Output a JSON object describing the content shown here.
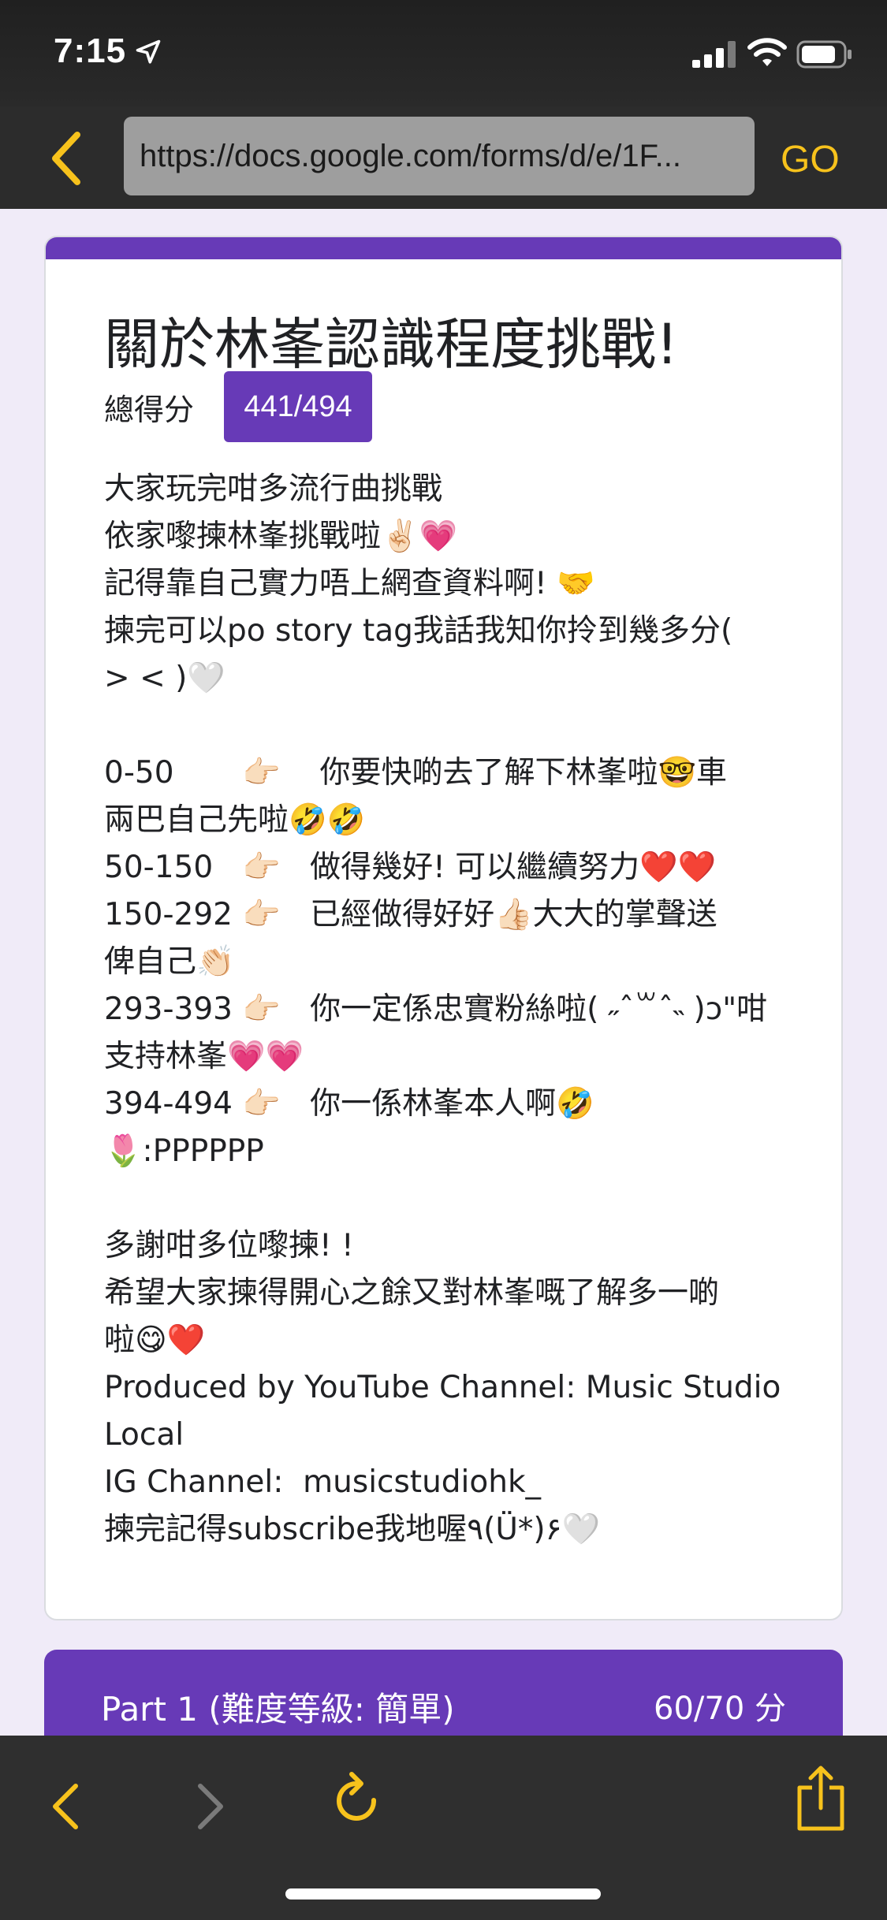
{
  "status_bar": {
    "time": "7:15"
  },
  "browser": {
    "url": "https://docs.google.com/forms/d/e/1F...",
    "go_label": "GO"
  },
  "form": {
    "title": "關於林峯認識程度挑戰!",
    "score_label": "總得分",
    "score_value": "441/494",
    "description_lines": [
      "大家玩完咁多流行曲挑戰",
      "依家嚟揀林峯挑戰啦✌🏻💗",
      "記得靠自己實力唔上網查資料啊! 🤝",
      "揀完可以po story tag我話我知你拎到幾多分(",
      "> < )🤍",
      "",
      "0-50       👉🏻    你要快啲去了解下林峯啦🤓車",
      "兩巴自己先啦🤣🤣",
      "50-150   👉🏻   做得幾好! 可以繼續努力❤️❤️",
      "150-292 👉🏻   已經做得好好👍🏻大大的掌聲送",
      "俾自己👏🏻",
      "293-393 👉🏻   你一定係忠實粉絲啦( ˶ˆ꒳ˆ˵ )ɔ\"咁",
      "支持林峯💗💗",
      "394-494 👉🏻   你一係林峯本人啊🤣",
      "🌷:PPPPPP",
      "",
      "多謝咁多位嚟揀! !",
      "希望大家揀得開心之餘又對林峯嘅了解多一啲",
      "啦😋❤️",
      "Produced by YouTube Channel: Music Studio",
      "Local",
      "IG Channel:  musicstudiohk_",
      "揀完記得subscribe我地喔٩(Ü*)۶🤍"
    ]
  },
  "section": {
    "title": "Part 1 (難度等級: 簡單)",
    "score": "60/70 分"
  },
  "icons": {
    "status": [
      "location-arrow-icon",
      "signal-icon",
      "wifi-icon",
      "battery-icon"
    ],
    "nav": [
      "back-chevron-icon",
      "forward-chevron-icon",
      "reload-icon",
      "share-icon"
    ]
  },
  "colors": {
    "accent": "#673ab7",
    "browser_accent": "#f7c21c",
    "page_background": "#f0ebf8"
  }
}
